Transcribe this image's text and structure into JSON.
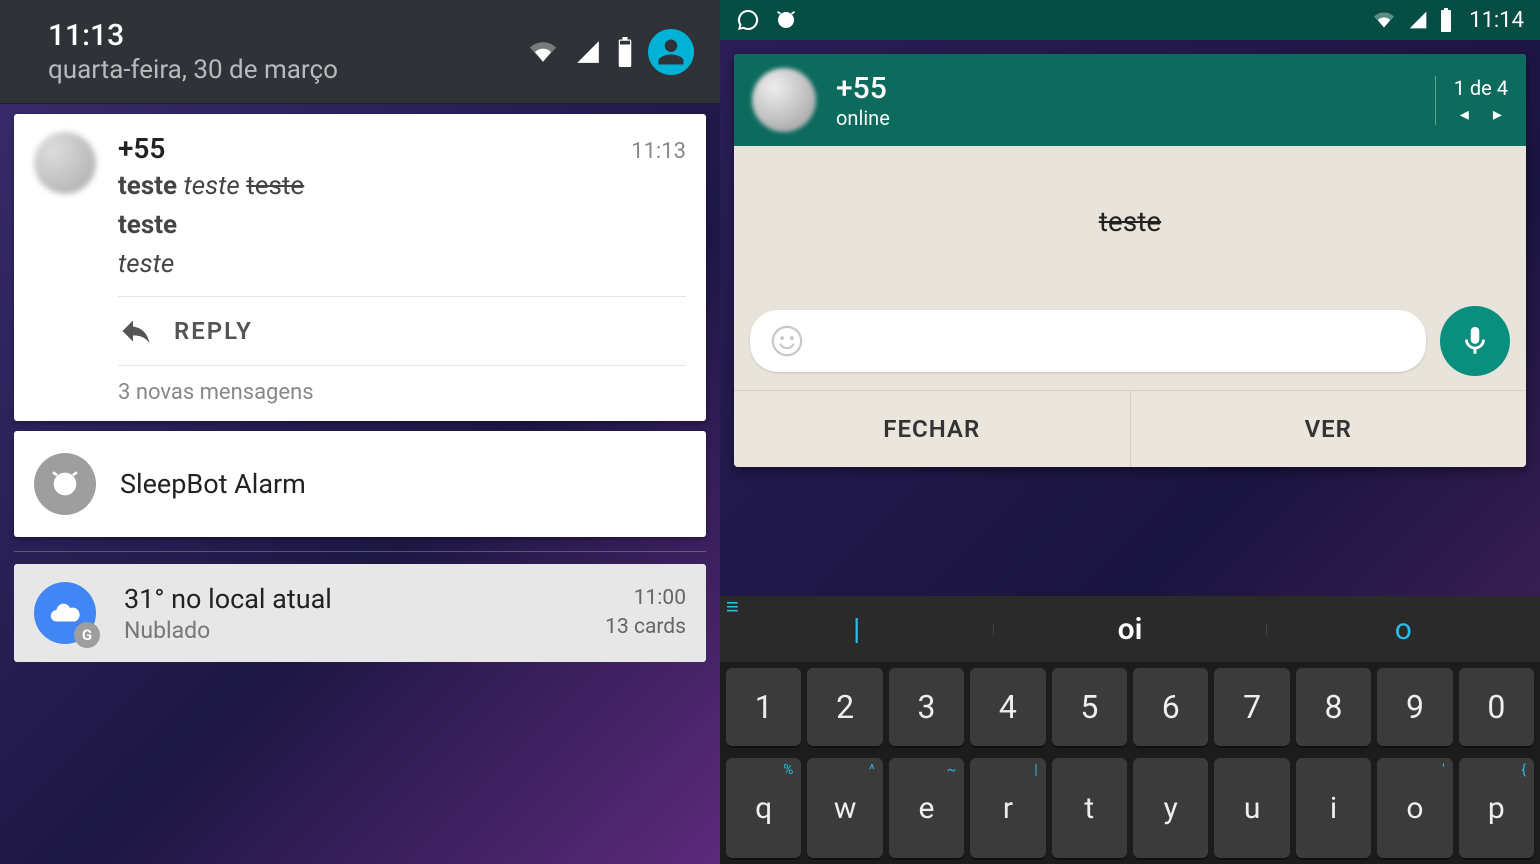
{
  "left": {
    "clock": "11:13",
    "date": "quarta-feira, 30 de março",
    "whatsapp": {
      "contact": "+55",
      "time": "11:13",
      "line1_bold": "teste",
      "line1_italic": "teste",
      "line1_strike": "teste",
      "line2_bold": "teste",
      "line3_italic": "teste",
      "reply": "REPLY",
      "more": "3 novas mensagens"
    },
    "sleepbot": {
      "title": "SleepBot Alarm"
    },
    "weather": {
      "title": "31° no local atual",
      "sub": "Nublado",
      "time": "11:00",
      "cards": "13 cards"
    }
  },
  "right": {
    "status_time": "11:14",
    "popup": {
      "contact": "+55",
      "status": "online",
      "counter": "1 de 4",
      "message": "teste",
      "action_close": "FECHAR",
      "action_view": "VER"
    },
    "suggestions": {
      "left": "|",
      "center": "oi",
      "right": "o"
    },
    "num_row": [
      "1",
      "2",
      "3",
      "4",
      "5",
      "6",
      "7",
      "8",
      "9",
      "0"
    ],
    "letter_row": [
      "q",
      "w",
      "e",
      "r",
      "t",
      "y",
      "u",
      "i",
      "o",
      "p"
    ],
    "letter_hints": [
      "%",
      "^",
      "~",
      "|",
      "",
      "",
      "",
      "",
      "'",
      "{"
    ]
  }
}
